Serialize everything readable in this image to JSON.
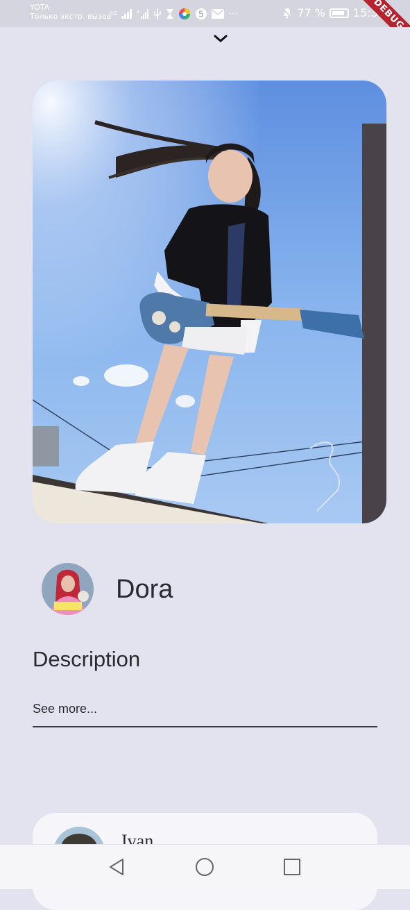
{
  "status_bar": {
    "carrier": "YOTA",
    "carrier_sub": "Только экстр. вызов",
    "network": "4G",
    "battery_percent": "77 %",
    "battery_level": 0.77,
    "time": "15:30",
    "debug_label": "DEBUG",
    "icons": [
      "signal-icon",
      "signal-off-icon",
      "usb-icon",
      "hourglass-icon",
      "color-wheel-icon",
      "five-badge-icon",
      "mail-icon",
      "more-icon",
      "bell-off-icon",
      "battery-icon"
    ]
  },
  "sheet": {
    "collapse_icon": "chevron-down-icon"
  },
  "profile": {
    "name": "Dora",
    "description_title": "Description",
    "see_more": "See more..."
  },
  "next_card": {
    "name": "Ivan"
  },
  "nav_bar": {
    "back_icon": "triangle-back-icon",
    "home_icon": "circle-home-icon",
    "recents_icon": "square-recents-icon"
  },
  "colors": {
    "background": "#E2E3EE",
    "text": "#2A2A2E",
    "debug_banner": "#B5242E",
    "card": "#F6F6FA"
  }
}
